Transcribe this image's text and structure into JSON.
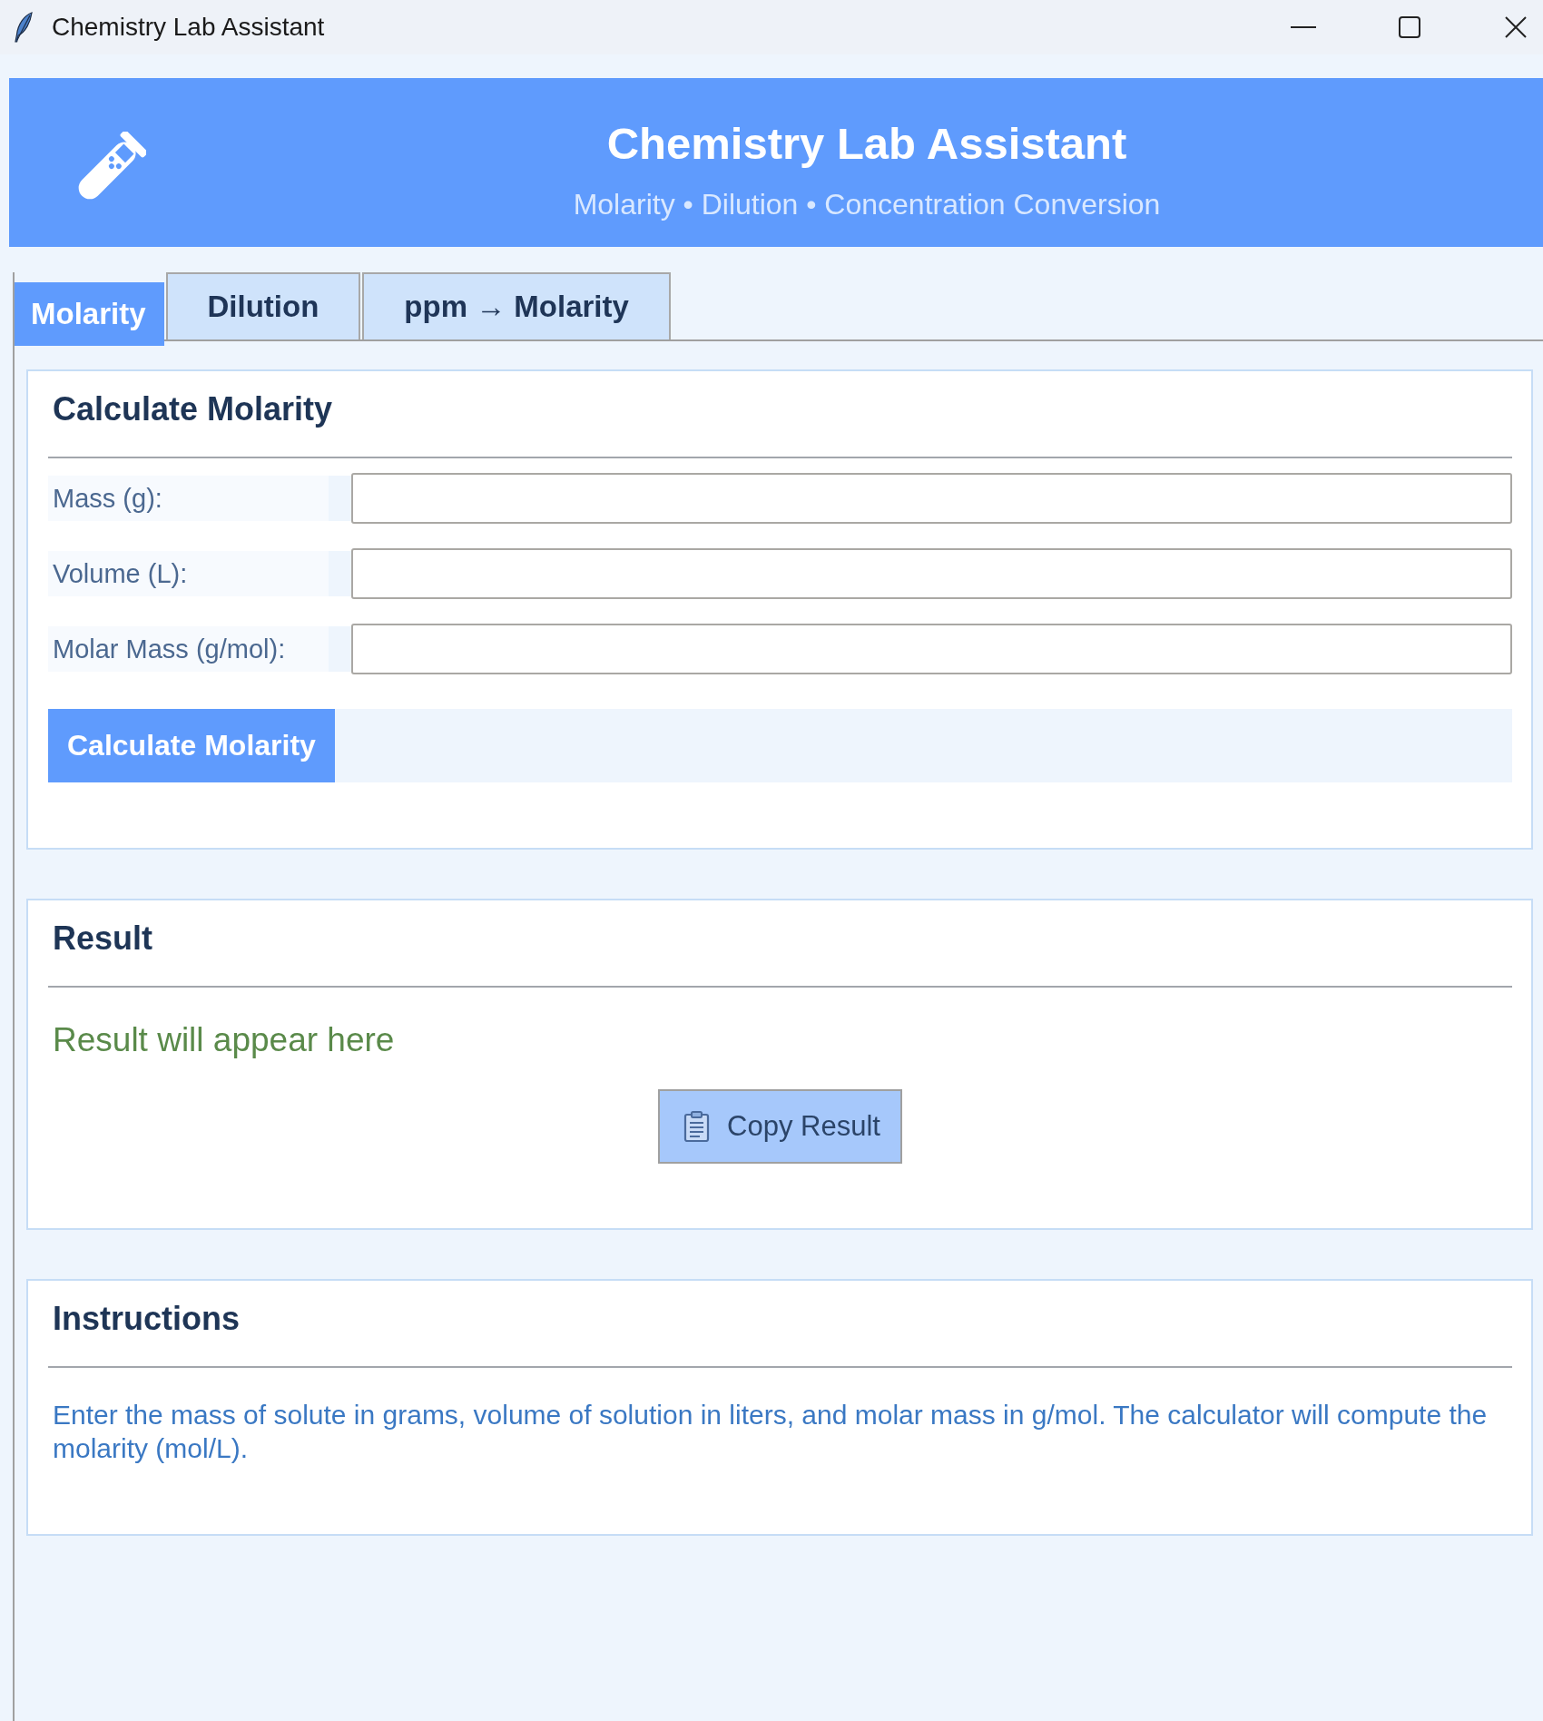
{
  "window": {
    "title": "Chemistry Lab Assistant"
  },
  "header": {
    "title": "Chemistry Lab Assistant",
    "subtitle": "Molarity • Dilution • Concentration Conversion"
  },
  "tabs": [
    {
      "label": "Molarity",
      "selected": true
    },
    {
      "label": "Dilution",
      "selected": false
    },
    {
      "label": "ppm → Molarity",
      "selected": false
    }
  ],
  "molarity_form": {
    "title": "Calculate Molarity",
    "fields": [
      {
        "label": "Mass (g):"
      },
      {
        "label": "Volume (L):"
      },
      {
        "label": "Molar Mass (g/mol):"
      }
    ],
    "submit_button": "Calculate Molarity"
  },
  "result": {
    "title": "Result",
    "text": "Result will appear here",
    "copy_button": "Copy Result"
  },
  "instructions": {
    "title": "Instructions",
    "text": "Enter the mass of solute in grams, volume of solution in liters, and molar mass in g/mol. The calculator will compute the molarity (mol/L)."
  }
}
